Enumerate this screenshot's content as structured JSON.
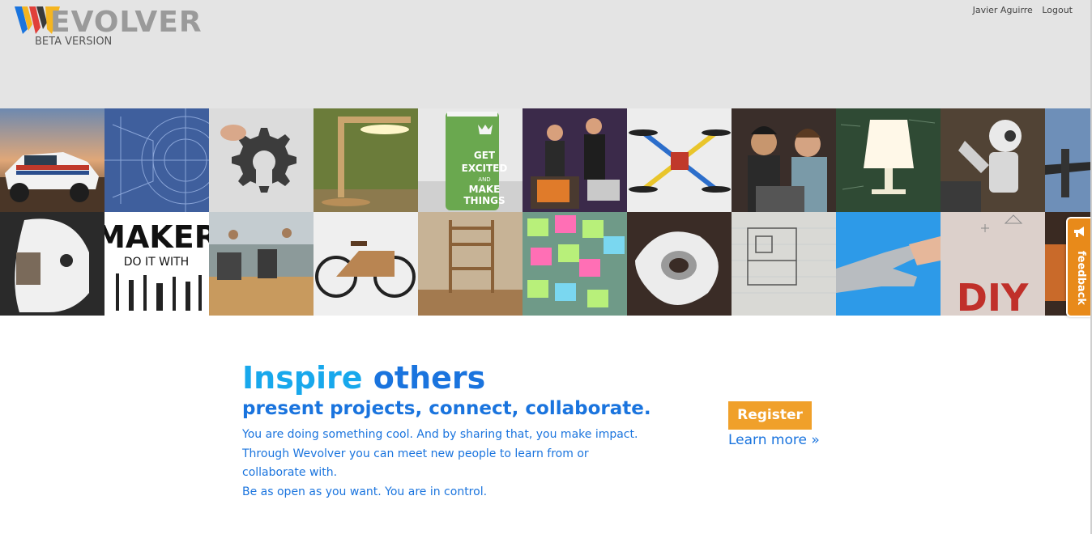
{
  "header": {
    "logo_text": "EVOLVER",
    "logo_subtitle": "BETA VERSION",
    "user_name": "Javier Aguirre",
    "logout_label": "Logout"
  },
  "mosaic": {
    "tiles_row1": [
      "rally-car",
      "blueprint",
      "gear-cutout",
      "wood-lamp",
      "get-excited-mug",
      "makers-group",
      "quadcopter",
      "two-engineers",
      "chalkboard-lamp",
      "humanoid-robot",
      "drone"
    ],
    "tiles_row2": [
      "robot-head",
      "maker-poster",
      "workshop",
      "wooden-bike",
      "wooden-chair",
      "sticky-notes",
      "3d-print-sculpture",
      "sketch-paper",
      "prosthetic-hand",
      "diy-sign",
      "orange-object"
    ],
    "mug_text": [
      "GET",
      "EXCITED",
      "AND",
      "MAKE",
      "THINGS"
    ],
    "maker_poster_text": [
      "MAKER",
      "DO IT WITH"
    ],
    "diy_text": "DIY"
  },
  "feedback": {
    "label": "feedback"
  },
  "hero": {
    "title_part1": "Inspire",
    "title_part2": "others",
    "subtitle": "present projects, connect, collaborate.",
    "line1": "You are doing something cool. And by sharing that, you make impact.",
    "line2": "Through Wevolver you can meet new people to learn from or",
    "line3": "collaborate with.",
    "line4": "Be as open as you want. You are in control."
  },
  "actions": {
    "register_label": "Register",
    "learn_more_label": "Learn more »"
  },
  "colors": {
    "accent_light_blue": "#18a8ec",
    "accent_blue": "#1a74de",
    "register_orange": "#f0a02a",
    "feedback_orange": "#e88a1a",
    "header_gray": "#e4e4e4"
  }
}
